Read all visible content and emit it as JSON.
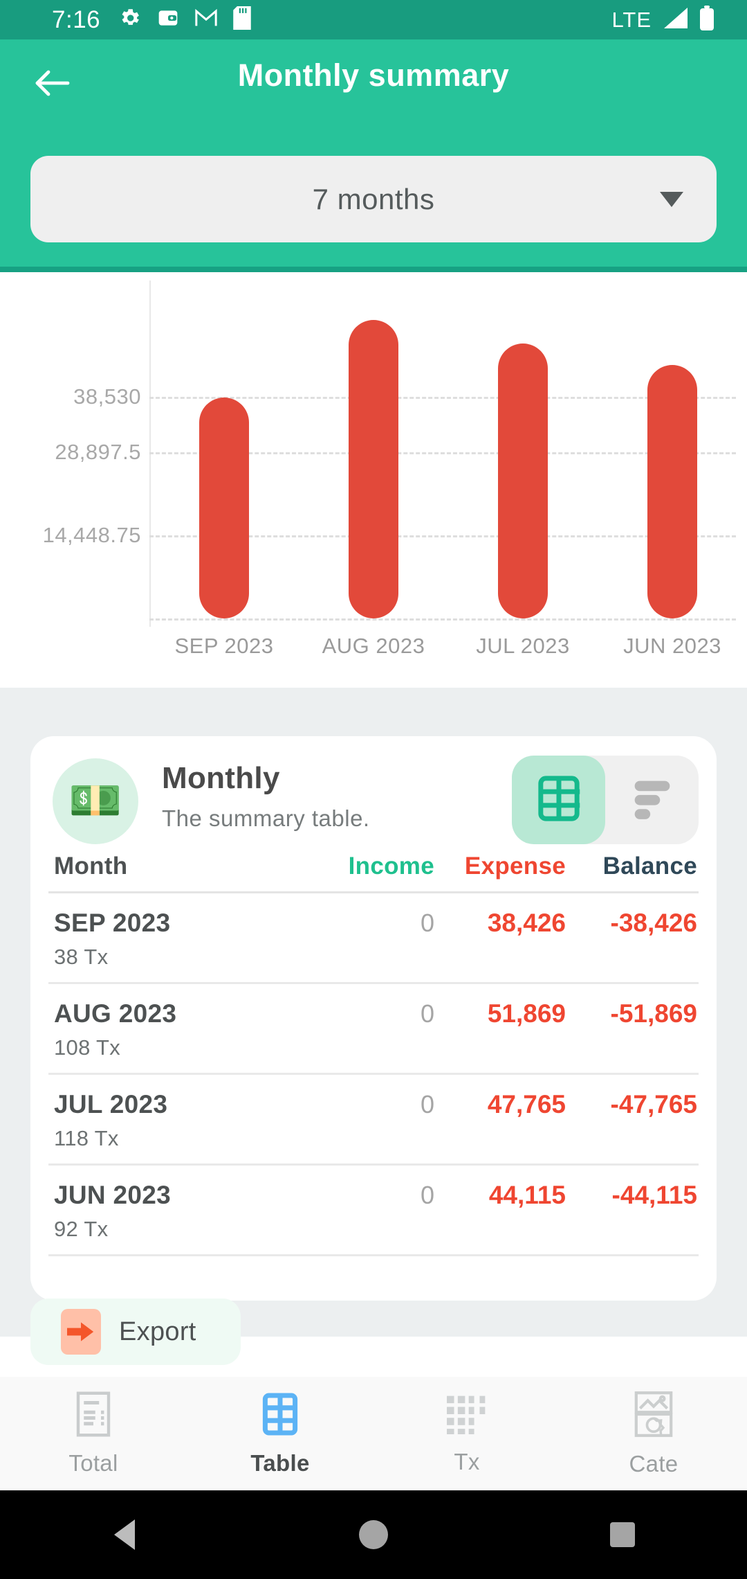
{
  "status_bar": {
    "time": "7:16",
    "icons": [
      "gear-icon",
      "wallet-icon",
      "gmail-icon",
      "sd-card-icon"
    ],
    "network": "LTE",
    "signal": "signal-icon",
    "battery": "battery-full-icon"
  },
  "header": {
    "back_label": "back-arrow-icon",
    "title": "Monthly summary",
    "range_selector": {
      "value": "7 months",
      "caret": "chevron-down-icon"
    }
  },
  "chart_data": {
    "type": "bar",
    "title": "",
    "xlabel": "",
    "ylabel": "",
    "categories": [
      "SEP 2023",
      "AUG 2023",
      "JUL 2023",
      "JUN 2023"
    ],
    "values": [
      38426,
      51869,
      47765,
      44115
    ],
    "series": [
      {
        "name": "Expense",
        "values": [
          38426,
          51869,
          47765,
          44115
        ],
        "color": "#e2493a"
      }
    ],
    "ytick_labels": [
      "38,530",
      "28,897.5",
      "14,448.75"
    ],
    "ytick_values": [
      38530,
      28897.5,
      14448.75
    ],
    "ylim": [
      0,
      57795
    ],
    "grid": true,
    "legend": false,
    "bar_color": "#e2493a",
    "note": "Horizontally scrollable; 4 of 7 months visible"
  },
  "card": {
    "icon": "money-banknotes-emoji",
    "emoji": "💵",
    "title": "Monthly",
    "subtitle": "The summary table.",
    "view_toggle": {
      "options": [
        "table-view",
        "list-view"
      ],
      "active": "table-view"
    },
    "table": {
      "columns": [
        "Month",
        "Income",
        "Expense",
        "Balance"
      ],
      "column_colors": {
        "month": "#4d5152",
        "income": "#1fc08e",
        "expense": "#ef4631",
        "balance": "#2f4858"
      },
      "rows": [
        {
          "month": "SEP 2023",
          "income": "0",
          "expense": "38,426",
          "balance": "-38,426",
          "tx": "38 Tx"
        },
        {
          "month": "AUG 2023",
          "income": "0",
          "expense": "51,869",
          "balance": "-51,869",
          "tx": "108 Tx"
        },
        {
          "month": "JUL 2023",
          "income": "0",
          "expense": "47,765",
          "balance": "-47,765",
          "tx": "118 Tx"
        },
        {
          "month": "JUN 2023",
          "income": "0",
          "expense": "44,115",
          "balance": "-44,115",
          "tx": "92 Tx"
        }
      ]
    }
  },
  "export": {
    "label": "Export",
    "icon": "export-arrow-icon"
  },
  "bottom_nav": {
    "items": [
      {
        "label": "Total",
        "icon": "document-icon",
        "active": false
      },
      {
        "label": "Table",
        "icon": "table-grid-icon",
        "active": true
      },
      {
        "label": "Tx",
        "icon": "dotted-list-icon",
        "active": false
      },
      {
        "label": "Cate",
        "icon": "category-image-icon",
        "active": false
      }
    ]
  },
  "android_nav": {
    "back": "triangle-back-icon",
    "home": "circle-home-icon",
    "recents": "square-recents-icon"
  },
  "colors": {
    "status_bar": "#189c7f",
    "header": "#27c39a",
    "accent_green": "#1fc08e",
    "expense_red": "#ef4631",
    "bar_red": "#e2493a",
    "page_bg": "#eceff0"
  }
}
